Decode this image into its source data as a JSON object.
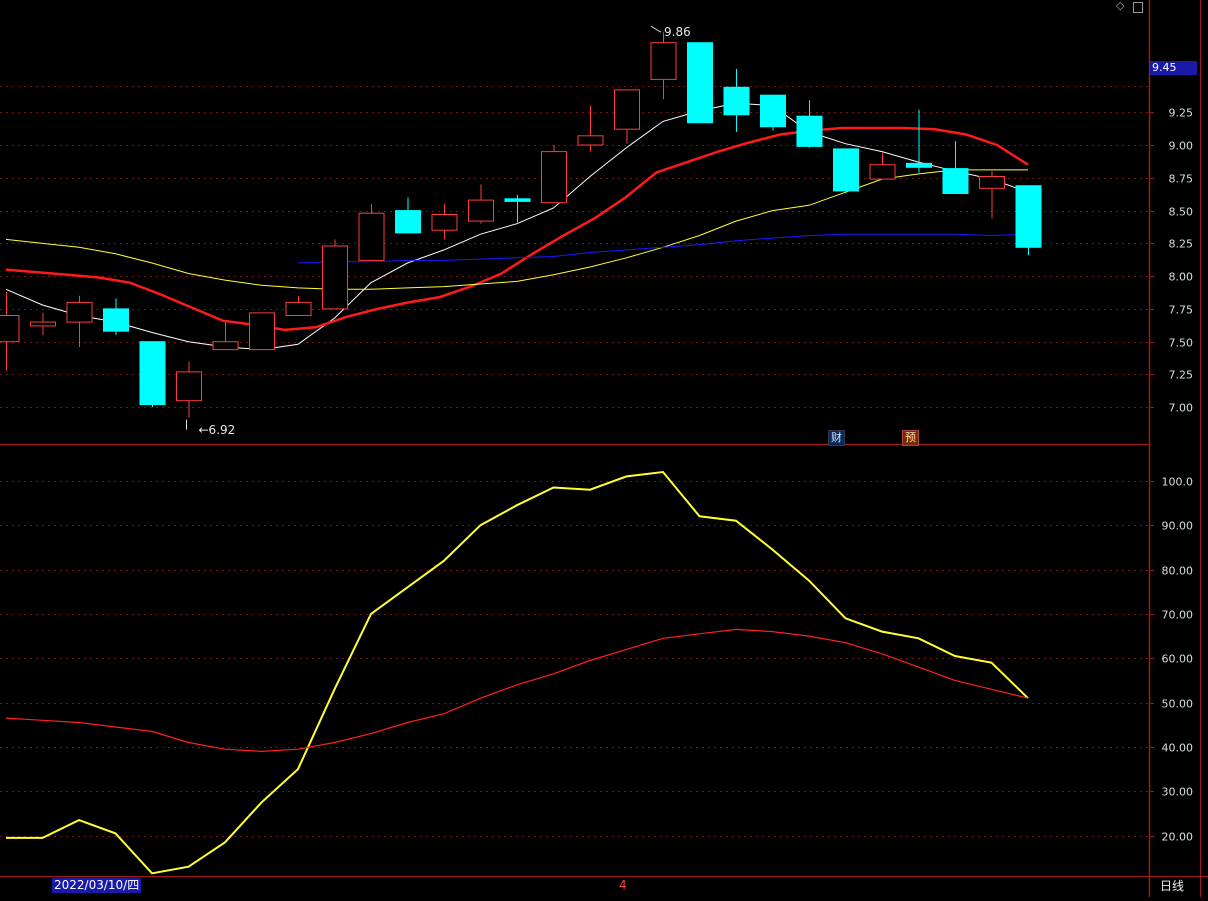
{
  "chart_data": [
    {
      "type": "candlestick",
      "title": "",
      "y_ticks": [
        "9.25",
        "9.00",
        "8.75",
        "8.50",
        "8.25",
        "8.00",
        "7.75",
        "7.50",
        "7.25",
        "7.00"
      ],
      "ylim": [
        6.88,
        9.9
      ],
      "current_price": "9.45",
      "candles": [
        {
          "o": 7.5,
          "h": 7.88,
          "l": 7.28,
          "c": 7.7
        },
        {
          "o": 7.62,
          "h": 7.72,
          "l": 7.55,
          "c": 7.65
        },
        {
          "o": 7.65,
          "h": 7.85,
          "l": 7.46,
          "c": 7.8
        },
        {
          "o": 7.75,
          "h": 7.83,
          "l": 7.55,
          "c": 7.58
        },
        {
          "o": 7.5,
          "h": 7.5,
          "l": 7.0,
          "c": 7.02
        },
        {
          "o": 7.05,
          "h": 7.35,
          "l": 6.92,
          "c": 7.27
        },
        {
          "o": 7.44,
          "h": 7.65,
          "l": 7.44,
          "c": 7.5
        },
        {
          "o": 7.44,
          "h": 7.72,
          "l": 7.44,
          "c": 7.72
        },
        {
          "o": 7.7,
          "h": 7.85,
          "l": 7.7,
          "c": 7.8
        },
        {
          "o": 7.75,
          "h": 8.28,
          "l": 7.75,
          "c": 8.23
        },
        {
          "o": 8.12,
          "h": 8.55,
          "l": 8.12,
          "c": 8.48
        },
        {
          "o": 8.5,
          "h": 8.6,
          "l": 8.33,
          "c": 8.33
        },
        {
          "o": 8.35,
          "h": 8.55,
          "l": 8.28,
          "c": 8.47
        },
        {
          "o": 8.42,
          "h": 8.7,
          "l": 8.4,
          "c": 8.58
        },
        {
          "o": 8.59,
          "h": 8.62,
          "l": 8.41,
          "c": 8.57
        },
        {
          "o": 8.56,
          "h": 9.0,
          "l": 8.56,
          "c": 8.95
        },
        {
          "o": 9.0,
          "h": 9.3,
          "l": 8.95,
          "c": 9.07
        },
        {
          "o": 9.12,
          "h": 9.35,
          "l": 9.01,
          "c": 9.42
        },
        {
          "o": 9.5,
          "h": 9.86,
          "l": 9.35,
          "c": 9.78
        },
        {
          "o": 9.78,
          "h": 9.78,
          "l": 9.17,
          "c": 9.17
        },
        {
          "o": 9.44,
          "h": 9.58,
          "l": 9.1,
          "c": 9.23
        },
        {
          "o": 9.38,
          "h": 9.38,
          "l": 9.11,
          "c": 9.14
        },
        {
          "o": 9.22,
          "h": 9.34,
          "l": 8.98,
          "c": 8.99
        },
        {
          "o": 8.97,
          "h": 8.97,
          "l": 8.63,
          "c": 8.65
        },
        {
          "o": 8.74,
          "h": 8.94,
          "l": 8.74,
          "c": 8.85
        },
        {
          "o": 8.86,
          "h": 9.27,
          "l": 8.79,
          "c": 8.83
        },
        {
          "o": 8.82,
          "h": 9.03,
          "l": 8.65,
          "c": 8.63
        },
        {
          "o": 8.67,
          "h": 8.8,
          "l": 8.44,
          "c": 8.76
        },
        {
          "o": 8.69,
          "h": 8.69,
          "l": 8.16,
          "c": 8.22
        }
      ],
      "ma_series": [
        {
          "color": "#ffffff",
          "values": [
            7.9,
            7.78,
            7.7,
            7.65,
            7.57,
            7.5,
            7.46,
            7.44,
            7.48,
            7.68,
            7.95,
            8.1,
            8.2,
            8.32,
            8.4,
            8.52,
            8.76,
            8.98,
            9.18,
            9.26,
            9.32,
            9.3,
            9.1,
            9.01,
            8.95,
            8.87,
            8.8,
            8.74,
            8.64
          ]
        },
        {
          "color": "#ff1a1a",
          "values": [
            8.05,
            8.03,
            8.01,
            7.99,
            7.95,
            7.86,
            7.76,
            7.66,
            7.63,
            7.59,
            7.61,
            7.69,
            7.75,
            7.8,
            7.84,
            7.92,
            8.02,
            8.17,
            8.31,
            8.44,
            8.6,
            8.79,
            8.87,
            8.95,
            9.02,
            9.08,
            9.11,
            9.13,
            9.13,
            9.13,
            9.12,
            9.08,
            9.0,
            8.85
          ]
        },
        {
          "color": "#ffff33",
          "values": [
            8.28,
            8.25,
            8.22,
            8.17,
            8.1,
            8.02,
            7.97,
            7.93,
            7.91,
            7.9,
            7.9,
            7.91,
            7.92,
            7.94,
            7.96,
            8.01,
            8.07,
            8.14,
            8.22,
            8.31,
            8.42,
            8.5,
            8.54,
            8.64,
            8.74,
            8.78,
            8.81,
            8.81,
            8.81
          ]
        },
        {
          "color": "#1a1aff",
          "values": [
            8.1,
            8.11,
            8.11,
            8.12,
            8.12,
            8.13,
            8.14,
            8.15,
            8.18,
            8.2,
            8.22,
            8.24,
            8.27,
            8.29,
            8.31,
            8.32,
            8.32,
            8.32,
            8.32,
            8.31,
            8.32
          ]
        }
      ],
      "annotations": {
        "high_label": "9.86",
        "low_label": "6.92"
      },
      "event_badges": [
        "财",
        "预"
      ]
    },
    {
      "type": "line",
      "y_ticks": [
        "100.0",
        "90.00",
        "80.00",
        "70.00",
        "60.00",
        "50.00",
        "40.00",
        "30.00",
        "20.00"
      ],
      "ylim": [
        10,
        106.5
      ],
      "series": [
        {
          "color": "#ffff33",
          "values": [
            19.5,
            19.5,
            23.5,
            20.5,
            11.5,
            13.0,
            18.5,
            27.5,
            35.0,
            53.0,
            70.0,
            76.0,
            82.0,
            90.0,
            94.5,
            98.5,
            98.0,
            101.0,
            102.0,
            92.0,
            91.0,
            84.5,
            77.5,
            69.0,
            66.0,
            64.5,
            60.5,
            59.0,
            51.0
          ]
        },
        {
          "color": "#ff2020",
          "values": [
            46.5,
            46.0,
            45.5,
            44.5,
            43.5,
            41.0,
            39.5,
            39.0,
            39.5,
            41.0,
            43.0,
            45.5,
            47.5,
            51.0,
            54.0,
            56.5,
            59.5,
            62.0,
            64.5,
            65.5,
            66.5,
            66.0,
            65.0,
            63.5,
            61.0,
            58.0,
            55.0,
            53.0,
            51.0
          ]
        }
      ]
    }
  ],
  "x_axis": {
    "date_label": "2022/03/10/四",
    "month_marker": "4"
  },
  "period_label": "日线"
}
